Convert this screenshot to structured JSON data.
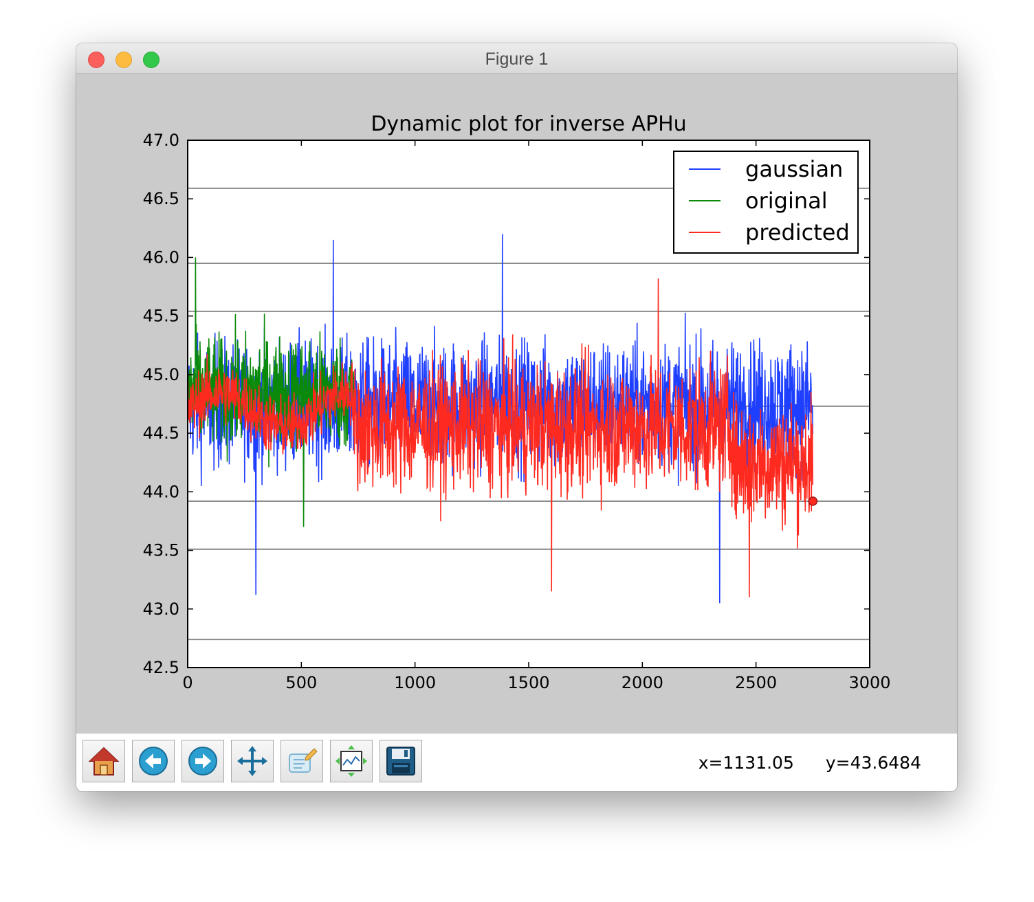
{
  "window": {
    "title": "Figure 1"
  },
  "toolbar": {
    "buttons": [
      {
        "name": "home-button",
        "icon": "home-icon"
      },
      {
        "name": "back-button",
        "icon": "back-arrow-icon"
      },
      {
        "name": "forward-button",
        "icon": "forward-arrow-icon"
      },
      {
        "name": "pan-button",
        "icon": "move-icon"
      },
      {
        "name": "zoom-button",
        "icon": "zoom-rect-icon"
      },
      {
        "name": "subplots-button",
        "icon": "subplots-icon"
      },
      {
        "name": "save-button",
        "icon": "floppy-disk-icon"
      }
    ],
    "x_readout": "x=1131.05",
    "y_readout": "y=43.6484"
  },
  "chart_data": {
    "type": "line",
    "title": "Dynamic plot for inverse APHu",
    "xlabel": "",
    "ylabel": "",
    "xlim": [
      0,
      3000
    ],
    "ylim": [
      42.5,
      47.0
    ],
    "x_ticks": [
      "0",
      "500",
      "1000",
      "1500",
      "2000",
      "2500",
      "3000"
    ],
    "y_ticks": [
      "42.5",
      "43.0",
      "43.5",
      "44.0",
      "44.5",
      "45.0",
      "45.5",
      "46.0",
      "46.5",
      "47.0"
    ],
    "horizontal_reference_lines": [
      46.59,
      45.95,
      45.54,
      44.73,
      43.92,
      43.51,
      42.74
    ],
    "legend_position": "top-right",
    "legend": [
      "gaussian",
      "original",
      "predicted"
    ],
    "colors": {
      "gaussian": "#1f3fff",
      "original": "#0a8a0a",
      "predicted": "#ff2a1f"
    },
    "series": [
      {
        "name": "gaussian",
        "color": "#1f3fff",
        "x_range": [
          0,
          2750
        ],
        "center": 44.75,
        "spread": 0.45,
        "extremes": {
          "max": [
            640,
            46.15
          ],
          "max2": [
            1385,
            46.2
          ],
          "min": [
            300,
            43.12
          ],
          "min2": [
            2340,
            43.05
          ]
        }
      },
      {
        "name": "original",
        "color": "#0a8a0a",
        "x_range": [
          0,
          730
        ],
        "center": 44.85,
        "spread": 0.4,
        "extremes": {
          "max": [
            35,
            46.0
          ],
          "min": [
            510,
            43.7
          ]
        }
      },
      {
        "name": "predicted",
        "color": "#ff2a1f",
        "x_range": [
          0,
          2750
        ],
        "center": 44.55,
        "spread": 0.45,
        "extremes": {
          "max": [
            2070,
            45.82
          ],
          "min": [
            1600,
            43.15
          ],
          "min2": [
            2470,
            43.1
          ]
        },
        "last_point": [
          2750,
          43.92
        ]
      }
    ]
  }
}
